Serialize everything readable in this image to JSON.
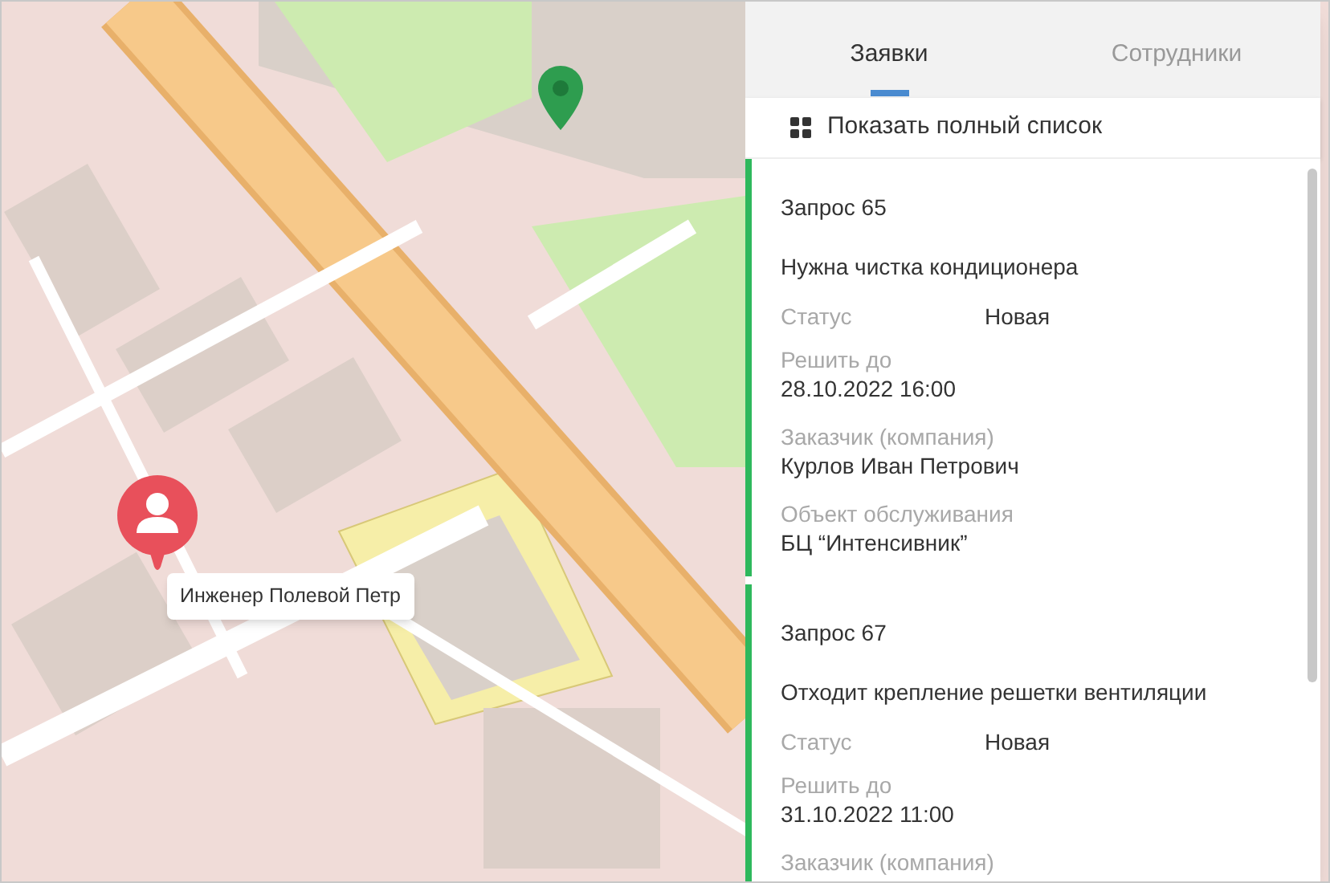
{
  "map": {
    "marker_tooltip": "Инженер Полевой Петр"
  },
  "tabs": [
    {
      "label": "Заявки",
      "selected": true
    },
    {
      "label": "Сотрудники",
      "selected": false
    }
  ],
  "show_all_link": "Показать полный список",
  "requests": [
    {
      "title": "Запрос 65",
      "description": "Нужна чистка кондиционера",
      "fields": [
        {
          "kind": "inline",
          "label": "Статус",
          "value": "Новая"
        },
        {
          "kind": "stacked",
          "label": "Решить до",
          "value": "28.10.2022 16:00"
        },
        {
          "kind": "stacked",
          "label": "Заказчик (компания)",
          "value": "Курлов Иван Петрович"
        },
        {
          "kind": "stacked",
          "label": "Объект обслуживания",
          "value": "БЦ “Интенсивник”"
        }
      ]
    },
    {
      "title": "Запрос 67",
      "description": "Отходит крепление решетки вентиляции",
      "fields": [
        {
          "kind": "inline",
          "label": "Статус",
          "value": "Новая"
        },
        {
          "kind": "stacked",
          "label": "Решить до",
          "value": "31.10.2022 11:00"
        },
        {
          "kind": "stacked",
          "label": "Заказчик (компания)"
        }
      ]
    }
  ]
}
